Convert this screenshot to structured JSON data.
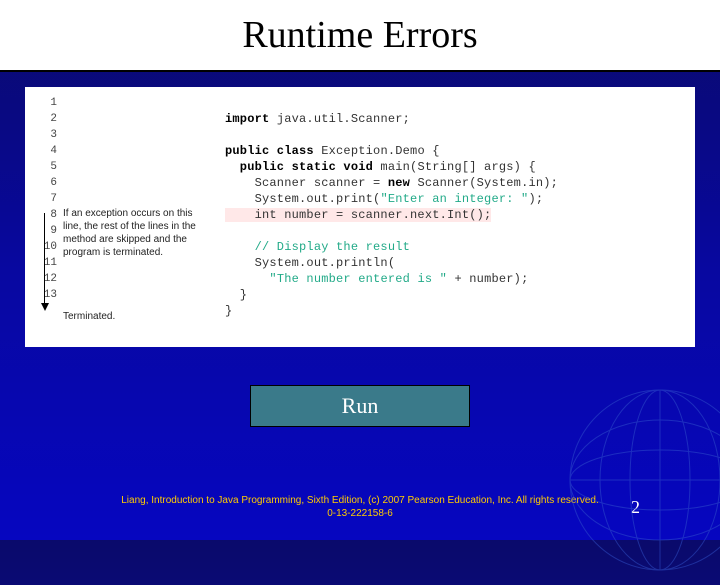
{
  "title": "Runtime Errors",
  "gutter": [
    "1",
    "2",
    "3",
    "4",
    "5",
    "6",
    "7",
    "8",
    "9",
    "10",
    "11",
    "12",
    "13"
  ],
  "annotation": "If an exception occurs on this line, the rest of the lines in the method are skipped and the program is terminated.",
  "terminated": "Terminated.",
  "code": {
    "l1a": "import",
    "l1b": " java.util.Scanner;",
    "l3a": "public class",
    "l3b": " Exception.Demo {",
    "l4a": "  public static void",
    "l4b": " main(String[] args) {",
    "l5a": "    Scanner scanner = ",
    "l5b": "new",
    "l5c": " Scanner(System.in);",
    "l6a": "    System.out.print(",
    "l6b": "\"Enter an integer: \"",
    "l6c": ");",
    "l7": "    int number = scanner.next.Int();",
    "l9": "    // Display the result",
    "l10": "    System.out.println(",
    "l11a": "      ",
    "l11b": "\"The number entered is \"",
    "l11c": " + number);",
    "l12": "  }",
    "l13": "}"
  },
  "run_label": "Run",
  "footer": "Liang, Introduction to Java Programming, Sixth Edition, (c) 2007 Pearson Education, Inc. All rights reserved. 0-13-222158-6",
  "page": "2"
}
